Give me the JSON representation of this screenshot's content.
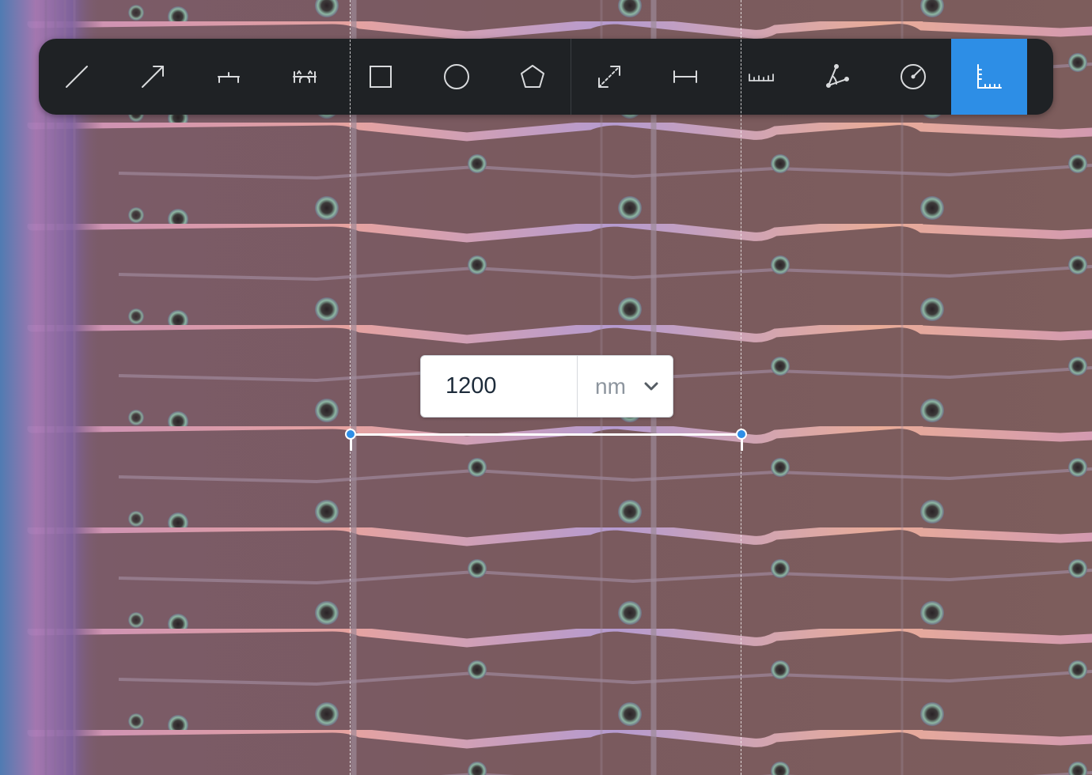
{
  "toolbar": {
    "draw_tools": [
      {
        "icon": "line-icon"
      },
      {
        "icon": "arrow-icon"
      },
      {
        "icon": "caliper-icon"
      },
      {
        "icon": "double-caliper-icon"
      },
      {
        "icon": "rectangle-icon"
      },
      {
        "icon": "circle-icon"
      },
      {
        "icon": "polygon-icon"
      }
    ],
    "measure_tools": [
      {
        "icon": "diagonal-distance-icon"
      },
      {
        "icon": "horizontal-distance-icon"
      },
      {
        "icon": "ruler-icon"
      },
      {
        "icon": "angle-icon"
      },
      {
        "icon": "radius-icon"
      },
      {
        "icon": "scale-calibration-icon",
        "active": true
      }
    ],
    "active_color": "#2d8ee6",
    "background_color": "#1f2225"
  },
  "calibration": {
    "value": "1200",
    "unit": "nm"
  }
}
